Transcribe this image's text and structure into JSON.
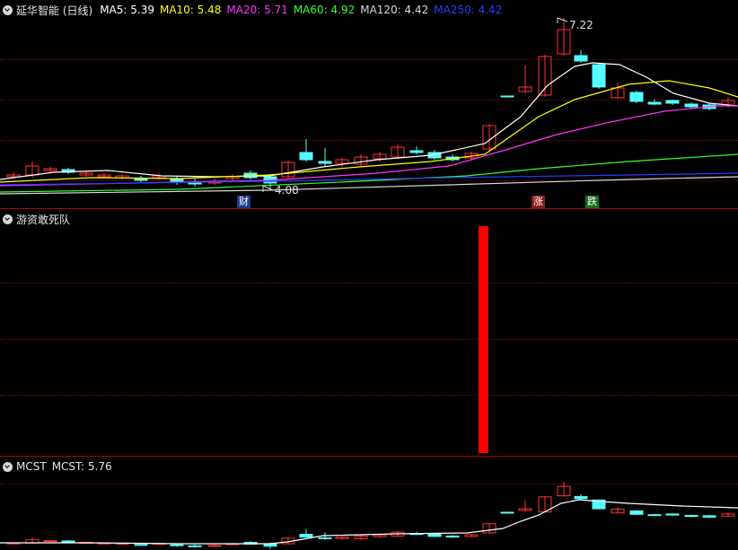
{
  "main": {
    "title": "延华智能 (日线)",
    "mas": [
      {
        "label": "MA5: 5.39",
        "color": "#ffffff"
      },
      {
        "label": "MA10: 5.48",
        "color": "#ffff00"
      },
      {
        "label": "MA20: 5.71",
        "color": "#ff33ff"
      },
      {
        "label": "MA60: 4.92",
        "color": "#33ff33"
      },
      {
        "label": "MA120: 4.42",
        "color": "#d8d8d8"
      },
      {
        "label": "MA250: 4.42",
        "color": "#2a3cff"
      }
    ],
    "high_label": "7.22",
    "low_label": "4.08",
    "tags": {
      "cai": "财",
      "zhang": "涨",
      "die": "跌"
    }
  },
  "indicator": {
    "title": "游资敢死队"
  },
  "mcst": {
    "title": "MCST",
    "value_label": "MCST: 5.76"
  },
  "colors": {
    "up": "#ff3232",
    "down": "#54ffff",
    "separator": "#bb0000",
    "signal_bar": "#ff0000"
  }
}
